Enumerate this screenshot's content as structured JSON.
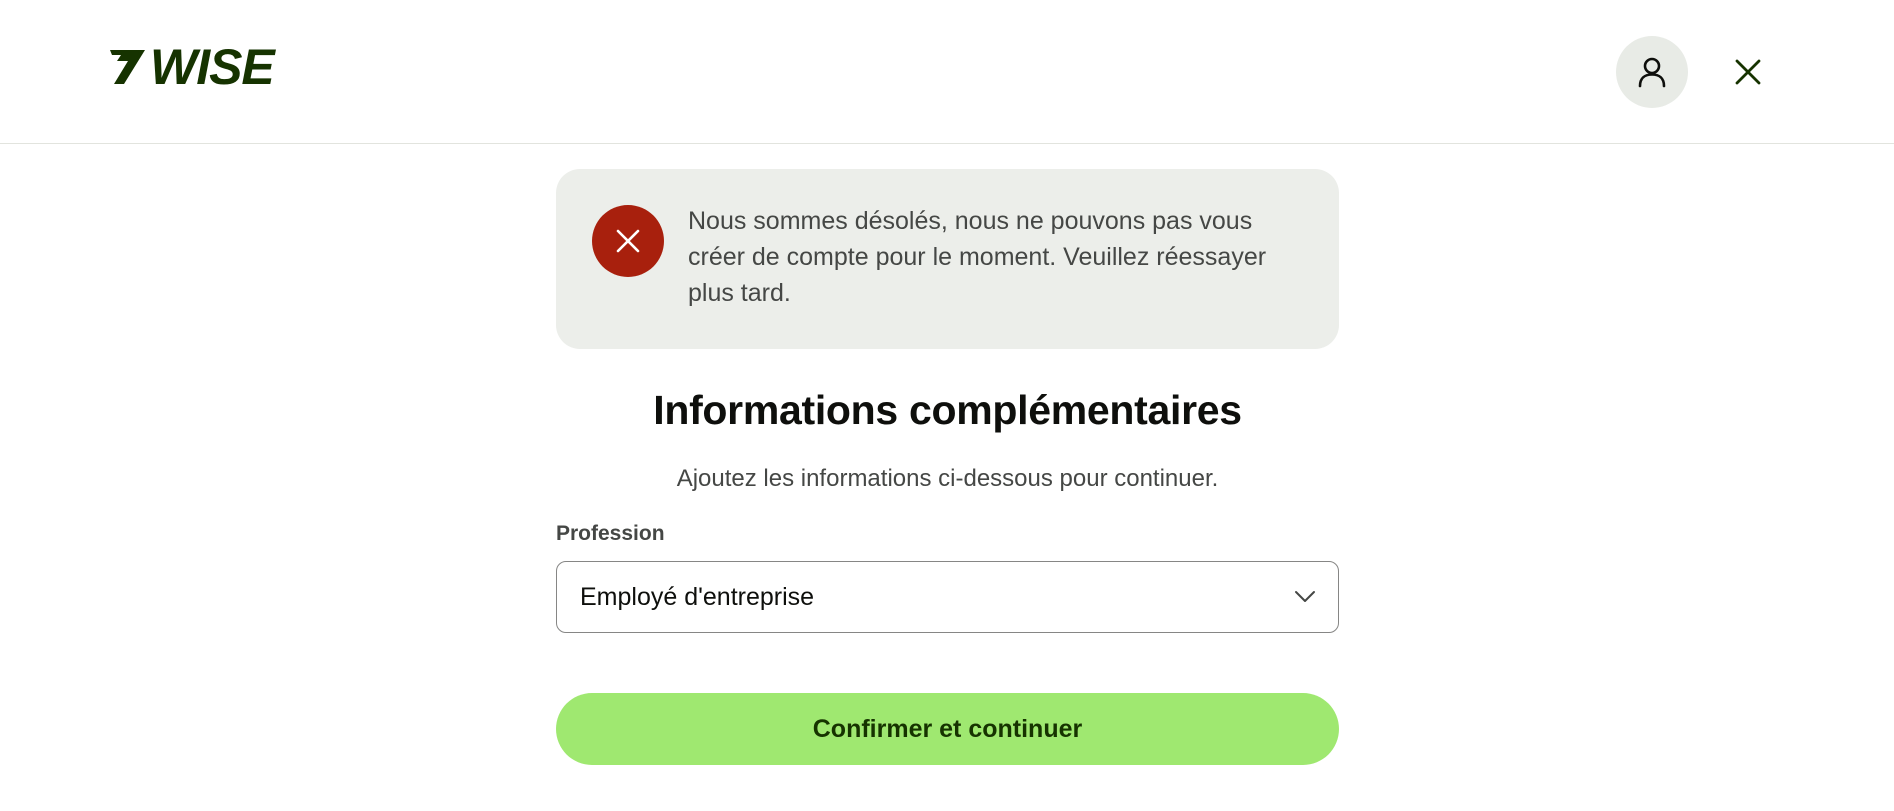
{
  "header": {
    "logo_text": "WISE",
    "account_icon": "person-icon",
    "close_icon": "close-icon"
  },
  "alert": {
    "icon": "close-icon",
    "message": "Nous sommes désolés, nous ne pouvons pas vous créer de compte pour le moment. Veuillez réessayer plus tard."
  },
  "main": {
    "title": "Informations complémentaires",
    "subtitle": "Ajoutez les informations ci-dessous pour continuer.",
    "profession": {
      "label": "Profession",
      "selected_value": "Employé d'entreprise",
      "icon": "chevron-down-icon"
    },
    "submit_label": "Confirmer et continuer"
  },
  "colors": {
    "brand_dark": "#163300",
    "brand_green": "#9fe870",
    "error_red": "#a8200d",
    "alert_bg": "#eceeea"
  }
}
